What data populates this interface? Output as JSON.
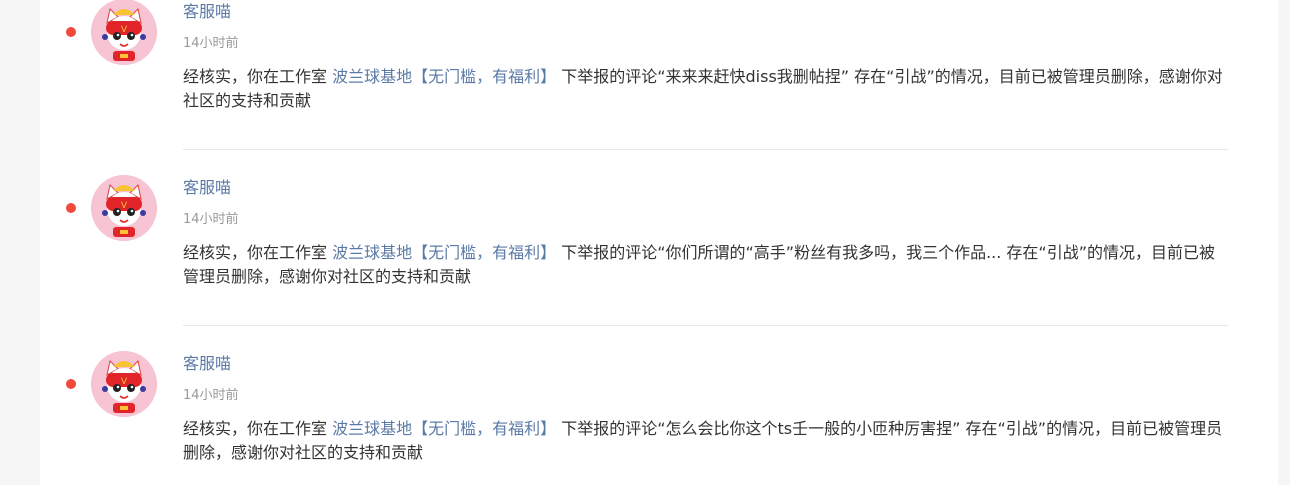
{
  "notifications": [
    {
      "author": "客服喵",
      "time": "14小时前",
      "prefix": "经核实，你在工作室",
      "studio": "波兰球基地【无门槛，有福利】",
      "suffix": "下举报的评论“来来来赶快diss我删帖捏” 存在“引战”的情况，目前已被管理员删除，感谢你对社区的支持和贡献"
    },
    {
      "author": "客服喵",
      "time": "14小时前",
      "prefix": "经核实，你在工作室",
      "studio": "波兰球基地【无门槛，有福利】",
      "suffix": "下举报的评论“你们所谓的“高手”粉丝有我多吗，我三个作品...  存在“引战”的情况，目前已被管理员删除，感谢你对社区的支持和贡献"
    },
    {
      "author": "客服喵",
      "time": "14小时前",
      "prefix": "经核实，你在工作室",
      "studio": "波兰球基地【无门槛，有福利】",
      "suffix": "下举报的评论“怎么会比你这个ts壬一般的小匝种厉害捏” 存在“引战”的情况，目前已被管理员删除，感谢你对社区的支持和贡献"
    }
  ],
  "colors": {
    "unread_dot": "#f04a3a",
    "link": "#5b7aa6",
    "avatar_bg": "#f6c4d2"
  },
  "icons": {
    "avatar": "cat-mascot-avatar-icon",
    "unread": "unread-dot-icon"
  }
}
